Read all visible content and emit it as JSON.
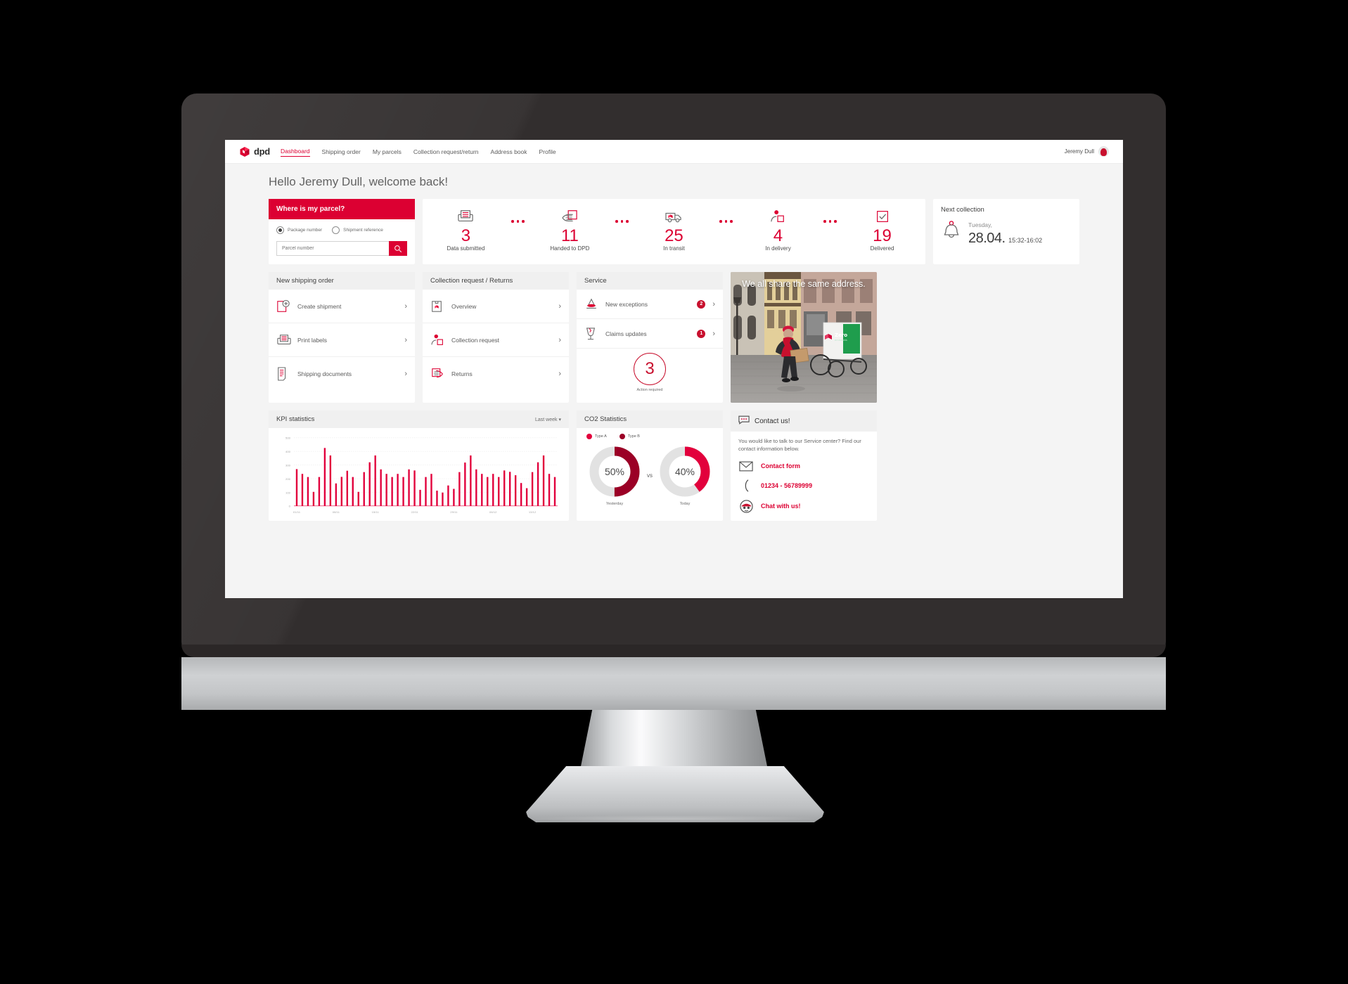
{
  "nav": {
    "brand": "dpd",
    "brand_icon": "dpd-parcel-logo-icon",
    "links": [
      {
        "label": "Dashboard",
        "active": true
      },
      {
        "label": "Shipping order",
        "active": false
      },
      {
        "label": "My parcels",
        "active": false
      },
      {
        "label": "Collection request/return",
        "active": false
      },
      {
        "label": "Address book",
        "active": false
      },
      {
        "label": "Profile",
        "active": false
      }
    ],
    "user_name": "Jeremy Dull"
  },
  "page_title": "Hello Jeremy Dull, welcome back!",
  "where_is_my_parcel": {
    "title": "Where is my parcel?",
    "radio_package": "Package number",
    "radio_shipment": "Shipment reference",
    "radio_selected": "Package number",
    "input_placeholder": "Parcel number",
    "input_value": "",
    "search_icon": "search-icon"
  },
  "stats": [
    {
      "icon": "printer-label-icon",
      "value": "3",
      "label": "Data submitted"
    },
    {
      "icon": "hand-parcel-icon",
      "value": "11",
      "label": "Handed to DPD"
    },
    {
      "icon": "delivery-van-icon",
      "value": "25",
      "label": "In transit"
    },
    {
      "icon": "courier-person-icon",
      "value": "4",
      "label": "In delivery"
    },
    {
      "icon": "checkbox-tick-icon",
      "value": "19",
      "label": "Delivered"
    }
  ],
  "next_collection": {
    "title": "Next collection",
    "icon": "bell-icon",
    "day": "Tuesday,",
    "date": "28.04.",
    "time": "15:32-16:02"
  },
  "new_shipping_order": {
    "header": "New shipping order",
    "items": [
      {
        "icon": "create-shipment-icon",
        "label": "Create shipment"
      },
      {
        "icon": "print-labels-icon",
        "label": "Print labels"
      },
      {
        "icon": "shipping-documents-icon",
        "label": "Shipping documents"
      }
    ]
  },
  "collection_returns": {
    "header": "Collection request / Returns",
    "items": [
      {
        "icon": "parcel-box-icon",
        "label": "Overview"
      },
      {
        "icon": "courier-person-icon",
        "label": "Collection request"
      },
      {
        "icon": "return-hand-icon",
        "label": "Returns"
      }
    ]
  },
  "service": {
    "header": "Service",
    "items": [
      {
        "icon": "exception-cone-icon",
        "label": "New exceptions",
        "badge": "2"
      },
      {
        "icon": "broken-glass-icon",
        "label": "Claims updates",
        "badge": "1"
      }
    ],
    "action_value": "3",
    "action_label": "Action required"
  },
  "promo": {
    "caption": "We all share the same address.",
    "alt": "dpd courier with cargo e-bike on cobbled street",
    "bike_label": "Zero",
    "bike_sublabel": "emissions"
  },
  "kpi": {
    "header": "KPI statistics",
    "filter_label": "Last week",
    "filter_icon": "chevron-down-icon"
  },
  "co2": {
    "header": "CO2 Statistics",
    "legend": [
      {
        "label": "Type A",
        "color": "#e2003c"
      },
      {
        "label": "Type B",
        "color": "#9b0026"
      }
    ],
    "vs_label": "vs",
    "donuts": [
      {
        "value": "50%",
        "label": "Yesterday",
        "percent": 50,
        "color": "#9b0026"
      },
      {
        "value": "40%",
        "label": "Today",
        "percent": 40,
        "color": "#e2003c"
      }
    ]
  },
  "contact": {
    "header": "Contact us!",
    "header_icon": "chat-bubble-icon",
    "description": "You would like to talk to our Service center? Find our contact information below.",
    "links": [
      {
        "icon": "envelope-icon",
        "label": "Contact form"
      },
      {
        "icon": "phone-icon",
        "label": "01234 - 56789999"
      },
      {
        "icon": "chat-avatar-icon",
        "label": "Chat with us!"
      }
    ]
  },
  "chart_data": {
    "type": "bar",
    "title": "KPI statistics",
    "xlabel": "",
    "ylabel": "",
    "ylim": [
      0,
      500
    ],
    "yticks": [
      0,
      100,
      200,
      300,
      400,
      500
    ],
    "grid": true,
    "legend": "none",
    "color": "#e2003c",
    "xtick_labels": [
      "01/11",
      "08/11",
      "15/11",
      "22/11",
      "29/11",
      "06/12",
      "13/12"
    ],
    "xtick_indices": [
      0,
      7,
      14,
      21,
      28,
      35,
      42
    ],
    "categories": [
      "01/11",
      "02/11",
      "03/11",
      "04/11",
      "05/11",
      "06/11",
      "07/11",
      "08/11",
      "09/11",
      "10/11",
      "11/11",
      "12/11",
      "13/11",
      "14/11",
      "15/11",
      "16/11",
      "17/11",
      "18/11",
      "19/11",
      "20/11",
      "21/11",
      "22/11",
      "23/11",
      "24/11",
      "25/11",
      "26/11",
      "27/11",
      "28/11",
      "29/11",
      "30/11",
      "01/12",
      "02/12",
      "03/12",
      "04/12",
      "05/12",
      "06/12",
      "07/12",
      "08/12",
      "09/12",
      "10/12",
      "11/12",
      "12/12",
      "13/12",
      "14/12",
      "15/12",
      "16/12",
      "17/12"
    ],
    "values": [
      270,
      235,
      212,
      103,
      212,
      425,
      370,
      165,
      213,
      258,
      212,
      103,
      248,
      320,
      370,
      268,
      235,
      212,
      235,
      212,
      268,
      260,
      118,
      212,
      235,
      112,
      98,
      150,
      125,
      248,
      318,
      370,
      268,
      235,
      212,
      235,
      212,
      260,
      250,
      225,
      168,
      130,
      248,
      320,
      370,
      235,
      212
    ]
  }
}
